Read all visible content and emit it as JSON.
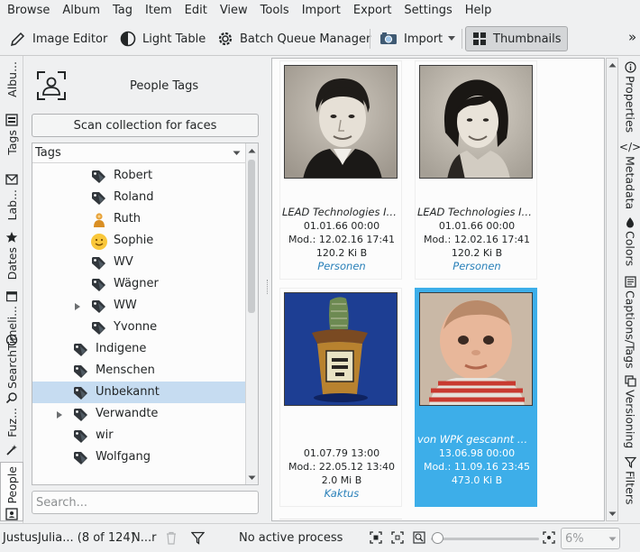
{
  "menubar": [
    "Browse",
    "Album",
    "Tag",
    "Item",
    "Edit",
    "View",
    "Tools",
    "Import",
    "Export",
    "Settings",
    "Help"
  ],
  "toolbar": {
    "image_editor": "Image Editor",
    "light_table": "Light Table",
    "batch_queue": "Batch Queue Manager",
    "import": "Import",
    "thumbnails": "Thumbnails",
    "overflow": "»"
  },
  "left_tabs": [
    "Albu...",
    "Tags",
    "Lab...",
    "Dates",
    "Timeli...",
    "Search",
    "Fuz...",
    "People"
  ],
  "right_tabs": [
    "Properties",
    "Metadata",
    "Colors",
    "Captions/Tags",
    "Versioning",
    "Filters"
  ],
  "people": {
    "title": "People Tags",
    "scan_button": "Scan collection for faces",
    "tree_header": "Tags",
    "search_placeholder": "Search...",
    "tree": [
      {
        "label": "Robert",
        "icon": "tag",
        "indent": 1,
        "expander": false,
        "selected": false
      },
      {
        "label": "Roland",
        "icon": "tag",
        "indent": 1,
        "expander": false,
        "selected": false
      },
      {
        "label": "Ruth",
        "icon": "person-avatar",
        "indent": 1,
        "expander": false,
        "selected": false
      },
      {
        "label": "Sophie",
        "icon": "smiley",
        "indent": 1,
        "expander": false,
        "selected": false
      },
      {
        "label": "WV",
        "icon": "tag",
        "indent": 1,
        "expander": false,
        "selected": false
      },
      {
        "label": "Wägner",
        "icon": "tag",
        "indent": 1,
        "expander": false,
        "selected": false
      },
      {
        "label": "WW",
        "icon": "tag",
        "indent": 1,
        "expander": true,
        "selected": false
      },
      {
        "label": "Yvonne",
        "icon": "tag",
        "indent": 1,
        "expander": false,
        "selected": false
      },
      {
        "label": "Indigene",
        "icon": "tag",
        "indent": 0,
        "expander": false,
        "selected": false
      },
      {
        "label": "Menschen",
        "icon": "tag",
        "indent": 0,
        "expander": false,
        "selected": false
      },
      {
        "label": "Unbekannt",
        "icon": "tag",
        "indent": 0,
        "expander": false,
        "selected": true
      },
      {
        "label": "Verwandte",
        "icon": "tag",
        "indent": 0,
        "expander": true,
        "selected": false
      },
      {
        "label": "wir",
        "icon": "tag",
        "indent": 0,
        "expander": false,
        "selected": false
      },
      {
        "label": "Wolfgang",
        "icon": "tag",
        "indent": 0,
        "expander": false,
        "selected": false
      }
    ]
  },
  "thumbnails": [
    {
      "name": "LEAD Technologies Inc...",
      "date": "01.01.66 00:00",
      "mod": "Mod.: 12.02.16 17:41",
      "size": "120.2 Ki B",
      "tag": "Personen",
      "selected": false
    },
    {
      "name": "LEAD Technologies Inc...",
      "date": "01.01.66 00:00",
      "mod": "Mod.: 12.02.16 17:41",
      "size": "120.2 Ki B",
      "tag": "Personen",
      "selected": false
    },
    {
      "name": "",
      "date": "01.07.79 13:00",
      "mod": "Mod.: 22.05.12 13:40",
      "size": "2.0 Mi B",
      "tag": "Kaktus",
      "selected": false
    },
    {
      "name": "von WPK gescannt mit...",
      "date": "13.06.98 00:00",
      "mod": "Mod.: 11.09.16 23:45",
      "size": "473.0 Ki B",
      "tag": "",
      "selected": true
    }
  ],
  "statusbar": {
    "item_info": "JustusJulia... (8 of 124)",
    "filter_text": "N...r",
    "process": "No active process",
    "zoom": "6%"
  },
  "colors": {
    "selection": "#3daee9",
    "tree_selection": "#c6dcf1",
    "tag_link": "#2980b9",
    "tag_icon": "#31363b"
  }
}
